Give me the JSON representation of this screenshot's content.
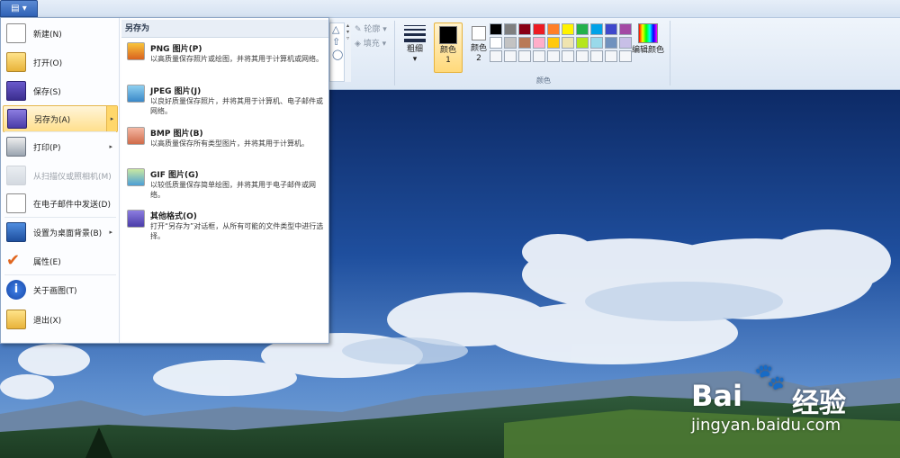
{
  "file_button": {
    "label": "▤ ▾"
  },
  "app_menu": {
    "items": [
      {
        "label": "新建(N)",
        "icon": "new-file-icon",
        "enabled": true,
        "submenu": false
      },
      {
        "label": "打开(O)",
        "icon": "open-folder-icon",
        "enabled": true,
        "submenu": false
      },
      {
        "label": "保存(S)",
        "icon": "save-disk-icon",
        "enabled": true,
        "submenu": false
      },
      {
        "label": "另存为(A)",
        "icon": "save-as-icon",
        "enabled": true,
        "submenu": true,
        "active": true
      },
      {
        "label": "打印(P)",
        "icon": "printer-icon",
        "enabled": true,
        "submenu": true
      },
      {
        "label": "从扫描仪或照相机(M)",
        "icon": "scanner-icon",
        "enabled": false,
        "submenu": false
      },
      {
        "label": "在电子邮件中发送(D)",
        "icon": "email-icon",
        "enabled": true,
        "submenu": false
      },
      {
        "label": "设置为桌面背景(B)",
        "icon": "desktop-icon",
        "enabled": true,
        "submenu": true
      },
      {
        "label": "属性(E)",
        "icon": "checkmark-icon",
        "enabled": true,
        "submenu": false
      },
      {
        "label": "关于画图(T)",
        "icon": "info-icon",
        "enabled": true,
        "submenu": false
      },
      {
        "label": "退出(X)",
        "icon": "exit-icon",
        "enabled": true,
        "submenu": false
      }
    ]
  },
  "save_as_submenu": {
    "header": "另存为",
    "items": [
      {
        "title": "PNG 图片(P)",
        "desc": "以高质量保存照片或绘图，并将其用于计算机或网络。",
        "icon": "png-image-icon"
      },
      {
        "title": "JPEG 图片(J)",
        "desc": "以良好质量保存照片，并将其用于计算机、电子邮件或网络。",
        "icon": "jpeg-image-icon"
      },
      {
        "title": "BMP 图片(B)",
        "desc": "以高质量保存所有类型图片，并将其用于计算机。",
        "icon": "bmp-image-icon"
      },
      {
        "title": "GIF 图片(G)",
        "desc": "以较低质量保存简单绘图，并将其用于电子邮件或网络。",
        "icon": "gif-image-icon"
      },
      {
        "title": "其他格式(O)",
        "desc": "打开“另存为”对话框，从所有可能的文件类型中进行选择。",
        "icon": "other-formats-icon"
      }
    ]
  },
  "ribbon": {
    "outline_label": "轮廓 ▾",
    "fill_label": "填充 ▾",
    "size_label": "粗细",
    "size_arrow": "▾",
    "color1_label": "颜色",
    "color1_num": "1",
    "color2_label": "颜色",
    "color2_num": "2",
    "colors_group_label": "颜色",
    "edit_colors_label": "编辑颜色",
    "palette_row1": [
      "#000000",
      "#7f7f7f",
      "#880015",
      "#ed1c24",
      "#ff7f27",
      "#fff200",
      "#22b14c",
      "#00a2e8",
      "#3f48cc",
      "#a349a4"
    ],
    "palette_row2": [
      "#ffffff",
      "#c3c3c3",
      "#b97a57",
      "#ffaec9",
      "#ffc90e",
      "#efe4b0",
      "#b5e61d",
      "#99d9ea",
      "#7092be",
      "#c8bfe7"
    ],
    "palette_row3_empty": 10
  },
  "watermark": {
    "brand": "Bai",
    "brand2": "经验",
    "url": "jingyan.baidu.com"
  }
}
